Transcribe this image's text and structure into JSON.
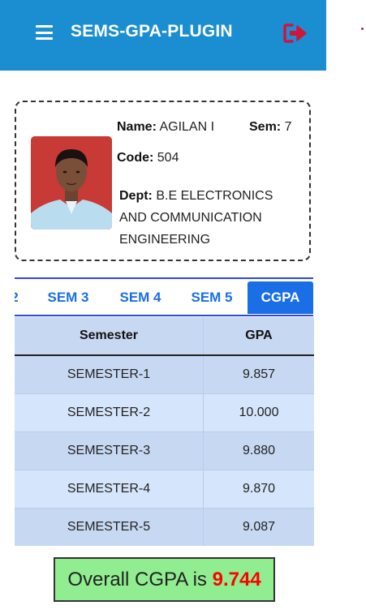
{
  "header": {
    "title": "SEMS-GPA-PLUGIN",
    "menu_icon": "hamburger-menu-icon",
    "logout_icon": "sign-out-icon",
    "colors": {
      "bar": "#1a8ed0",
      "logout": "#d2143a"
    }
  },
  "profile": {
    "name_label": "Name:",
    "name": "AGILAN I",
    "sem_label": "Sem:",
    "sem": "7",
    "code_label": "Code:",
    "code": "504",
    "dept_label": "Dept:",
    "dept": "B.E ELECTRONICS AND COMMUNICATION ENGINEERING"
  },
  "tabs": [
    {
      "label": "2"
    },
    {
      "label": "SEM 3"
    },
    {
      "label": "SEM 4"
    },
    {
      "label": "SEM 5"
    },
    {
      "label": "CGPA",
      "active": true
    }
  ],
  "table": {
    "headers": [
      "Semester",
      "GPA"
    ],
    "rows": [
      {
        "semester": "SEMESTER-1",
        "gpa": "9.857"
      },
      {
        "semester": "SEMESTER-2",
        "gpa": "10.000"
      },
      {
        "semester": "SEMESTER-3",
        "gpa": "9.880"
      },
      {
        "semester": "SEMESTER-4",
        "gpa": "9.870"
      },
      {
        "semester": "SEMESTER-5",
        "gpa": "9.087"
      }
    ]
  },
  "result": {
    "label": "Overall CGPA is",
    "value": "9.744",
    "colors": {
      "box": "#90ee90",
      "value": "#ff0000"
    }
  }
}
